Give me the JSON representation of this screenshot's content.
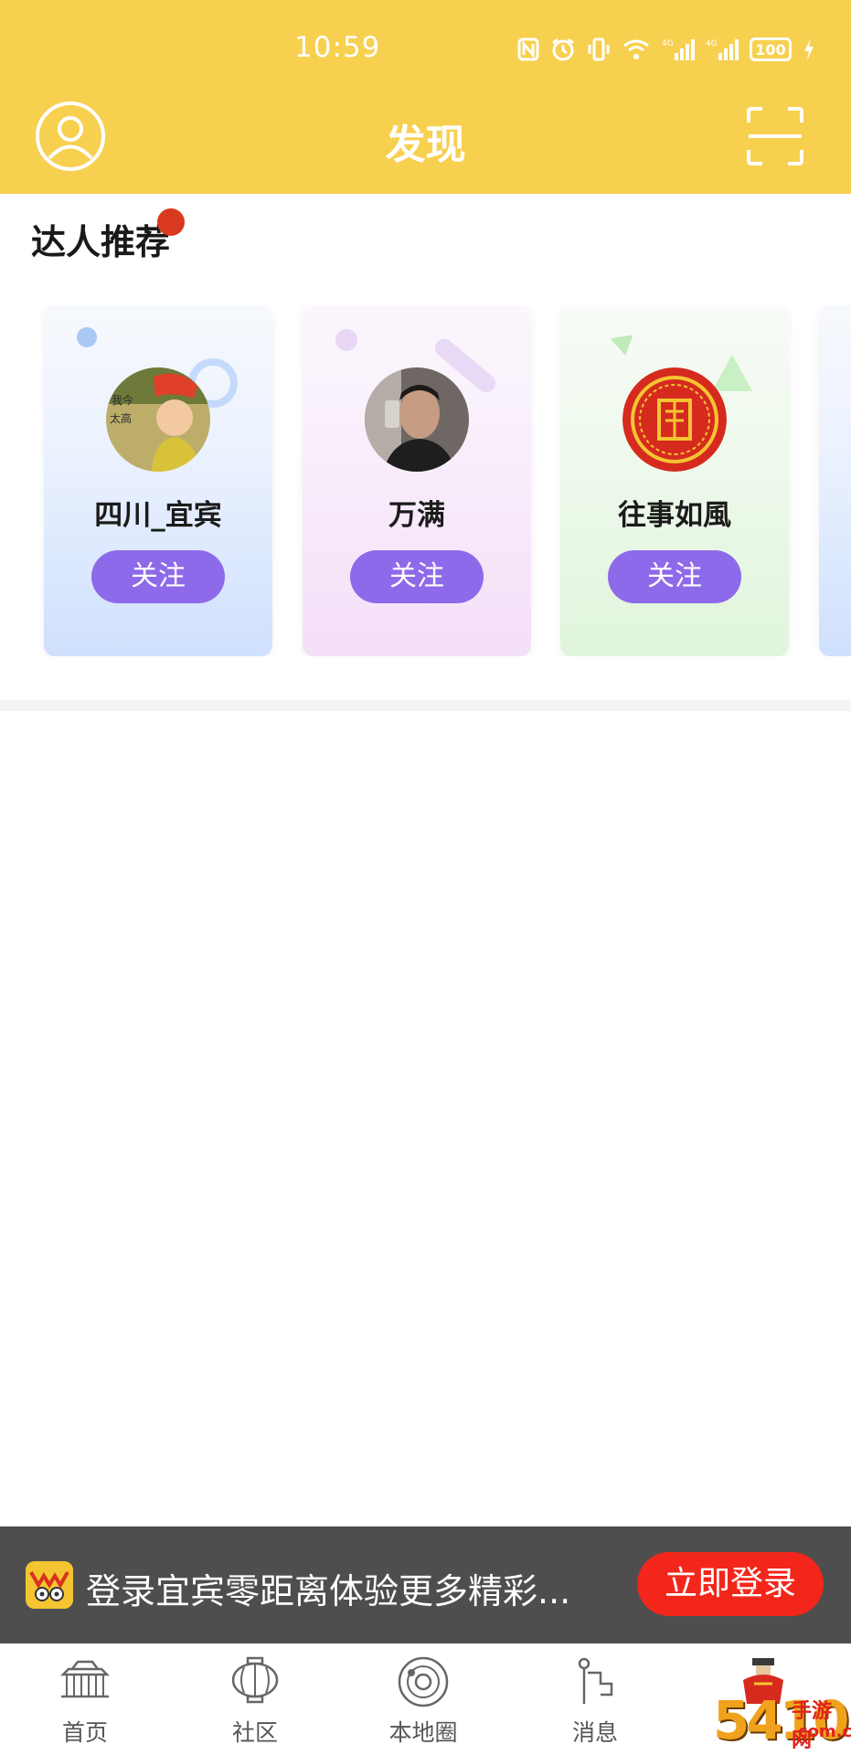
{
  "status_bar": {
    "time": "10:59",
    "battery": "100",
    "icons": [
      "nfc-icon",
      "alarm-icon",
      "vibrate-icon",
      "wifi-icon",
      "signal-4g-icon",
      "signal-4g-icon",
      "battery-icon",
      "charging-icon"
    ]
  },
  "header": {
    "title": "发现",
    "left_icon": "user-avatar-icon",
    "right_icon": "scan-icon",
    "background": "#f7d04f"
  },
  "recommend": {
    "title": "达人推荐",
    "cards": [
      {
        "name": "四川_宜宾",
        "follow_label": "关注",
        "theme": "blue"
      },
      {
        "name": "万满",
        "follow_label": "关注",
        "theme": "pink"
      },
      {
        "name": "往事如風",
        "follow_label": "关注",
        "theme": "green"
      }
    ],
    "accent": "#8d6ae9"
  },
  "login_banner": {
    "text": "登录宜宾零距离体验更多精彩...",
    "button_label": "立即登录",
    "button_color": "#f2261b"
  },
  "bottom_nav": {
    "items": [
      {
        "label": "首页",
        "icon": "home-building-icon"
      },
      {
        "label": "社区",
        "icon": "lantern-icon"
      },
      {
        "label": "本地圈",
        "icon": "planet-icon"
      },
      {
        "label": "消息",
        "icon": "message-flag-icon"
      },
      {
        "label": "",
        "icon": "mascot-icon"
      }
    ]
  },
  "watermark": {
    "number": "5410",
    "text": "手游网",
    "domain": ".com.cn"
  }
}
